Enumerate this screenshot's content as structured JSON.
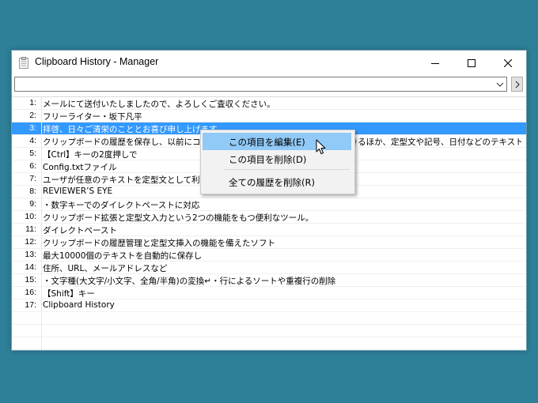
{
  "window": {
    "title": "Clipboard History - Manager",
    "icon": "clipboard-icon"
  },
  "toolbar": {
    "combo_value": "",
    "combo_icon": "chevron-down-icon",
    "go_icon": "chevron-right-icon"
  },
  "list": {
    "selected_index": 3,
    "items": [
      {
        "num": "1:",
        "text": "メールにて送付いたしましたので、よろしくご査収ください。"
      },
      {
        "num": "2:",
        "text": "フリーライター・坂下凡平"
      },
      {
        "num": "3:",
        "text": "拝啓、日々ご清栄のこととお喜び申し上げます。"
      },
      {
        "num": "4:",
        "text": "クリップボードの履歴を保存し、以前にコピーしたテキストを呼び出して再利用できるほか、定型文や記号、日付などのテキストを簡..."
      },
      {
        "num": "5:",
        "text": "【Ctrl】キーの2度押しで"
      },
      {
        "num": "6:",
        "text": "Config.txtファイル"
      },
      {
        "num": "7:",
        "text": "ユーザが任意のテキストを定型文として利用できる"
      },
      {
        "num": "8:",
        "text": "REVIEWER’S EYE"
      },
      {
        "num": "9:",
        "text": "・数字キーでのダイレクトペーストに対応"
      },
      {
        "num": "10:",
        "text": "クリップボード拡張と定型文入力という2つの機能をもつ便利なツール。"
      },
      {
        "num": "11:",
        "text": "ダイレクトペースト"
      },
      {
        "num": "12:",
        "text": "クリップボードの履歴管理と定型文挿入の機能を備えたソフト"
      },
      {
        "num": "13:",
        "text": "最大10000個のテキストを自動的に保存し"
      },
      {
        "num": "14:",
        "text": "住所、URL、メールアドレスなど"
      },
      {
        "num": "15:",
        "text": "・文字種(大文字/小文字、全角/半角)の変換↵・行によるソートや重複行の削除"
      },
      {
        "num": "16:",
        "text": "【Shift】キー"
      },
      {
        "num": "17:",
        "text": "Clipboard History"
      }
    ]
  },
  "context_menu": {
    "items": [
      {
        "label": "この項目を編集(E)",
        "highlighted": true
      },
      {
        "label": "この項目を削除(D)",
        "highlighted": false
      },
      {
        "label": "全ての履歴を削除(R)",
        "highlighted": false
      }
    ]
  },
  "colors": {
    "desktop": "#2e7f98",
    "selection": "#3399ff",
    "menu_highlight": "#91c9f7"
  }
}
